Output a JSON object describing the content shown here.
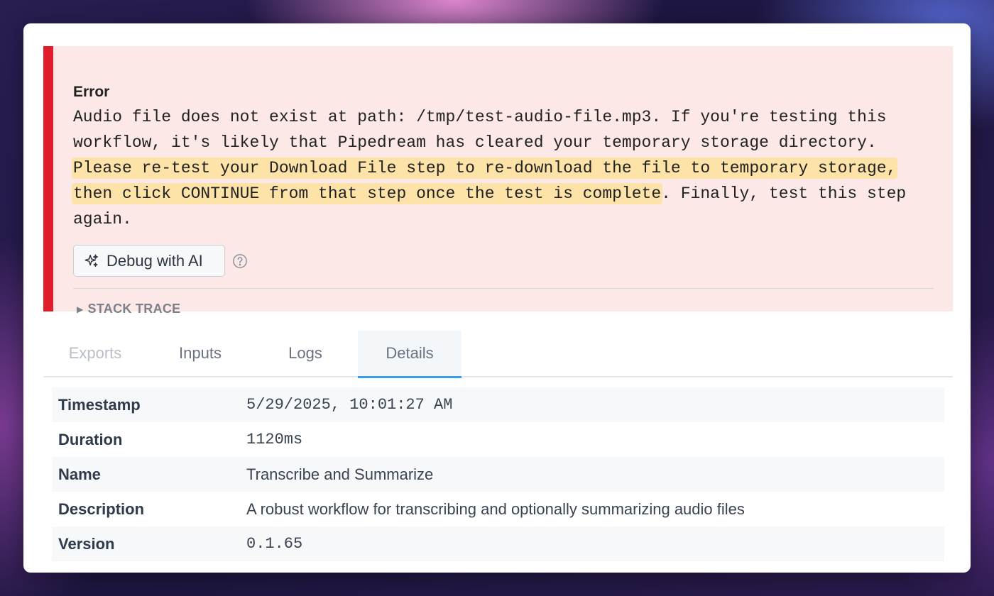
{
  "error": {
    "title": "Error",
    "lines": [
      {
        "plain": "Audio file does not exist at path: /tmp/test-audio-file.mp3. If you're testing this",
        "highlight": "",
        "after": ""
      },
      {
        "plain": "workflow, it's likely that Pipedream has cleared your temporary storage directory.",
        "highlight": "",
        "after": ""
      },
      {
        "plain": "",
        "highlight": "Please re-test your Download File step to re-download the file to temporary storage,",
        "after": ""
      },
      {
        "plain": "",
        "highlight": "then click CONTINUE from that step once the test is complete",
        "after": ". Finally, test this step"
      },
      {
        "plain": "again.",
        "highlight": "",
        "after": ""
      }
    ],
    "highlight_color": "#fde3a7",
    "accent_color": "#e11d2b",
    "debug_button": {
      "label": "Debug with AI",
      "icon": "sparkles-icon"
    },
    "help_icon": "question-circle-icon",
    "stack_trace_label": "STACK TRACE"
  },
  "tabs": [
    {
      "label": "Exports",
      "state": "disabled"
    },
    {
      "label": "Inputs",
      "state": "normal"
    },
    {
      "label": "Logs",
      "state": "normal"
    },
    {
      "label": "Details",
      "state": "active"
    }
  ],
  "details": [
    {
      "key": "Timestamp",
      "value": "5/29/2025, 10:01:27 AM",
      "mono": true
    },
    {
      "key": "Duration",
      "value": "1120ms",
      "mono": true
    },
    {
      "key": "Name",
      "value": "Transcribe and Summarize",
      "mono": false
    },
    {
      "key": "Description",
      "value": "A robust workflow for transcribing and optionally summarizing audio files",
      "mono": false
    },
    {
      "key": "Version",
      "value": "0.1.65",
      "mono": true
    }
  ]
}
